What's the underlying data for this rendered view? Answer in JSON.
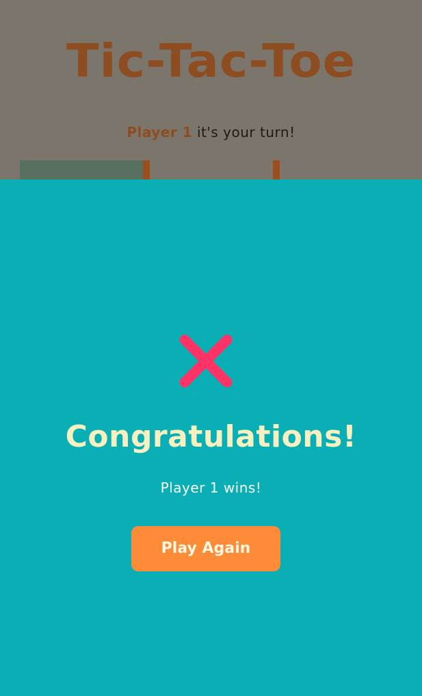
{
  "game": {
    "title": "Tic-Tac-Toe",
    "turn_player": "Player 1",
    "turn_suffix": "it's your turn!"
  },
  "modal": {
    "icon": "x-mark-icon",
    "heading": "Congratulations!",
    "message": "Player 1 wins!",
    "button_label": "Play Again"
  },
  "colors": {
    "overlay": "#0aaeb5",
    "x_mark": "#ff3366",
    "heading": "#f7f0c1",
    "button": "#fd8b38",
    "title": "#8d4d20"
  }
}
